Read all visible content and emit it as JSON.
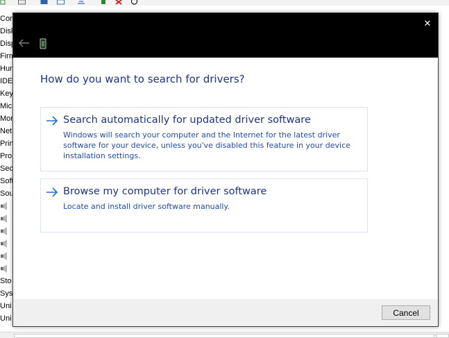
{
  "background": {
    "device_list": [
      "Com",
      "Disk",
      "Disp",
      "Firm",
      "Hum",
      "IDE",
      "Key",
      "Mic",
      "Mon",
      "Net",
      "Prin",
      "Pro",
      "Sec",
      "Soft",
      "Sou",
      "",
      "",
      "",
      "",
      "",
      "",
      "Sto",
      "Syst",
      "Uni",
      "Uni"
    ],
    "toolbar_icons": [
      "properties-icon",
      "update-driver-icon",
      "scan-hardware-icon",
      "uninstall-icon",
      "disable-icon"
    ]
  },
  "dialog": {
    "close_glyph": "✕",
    "heading": "How do you want to search for drivers?",
    "options": [
      {
        "title": "Search automatically for updated driver software",
        "description": "Windows will search your computer and the Internet for the latest driver software for your device, unless you've disabled this feature in your device installation settings."
      },
      {
        "title": "Browse my computer for driver software",
        "description": "Locate and install driver software manually."
      }
    ],
    "cancel_label": "Cancel"
  },
  "colors": {
    "title_bar": "#000000",
    "heading": "#1e3287",
    "link": "#1e3287",
    "description": "#1f4cad",
    "arrow": "#1f6fd1",
    "footer": "#f0f0f0"
  }
}
